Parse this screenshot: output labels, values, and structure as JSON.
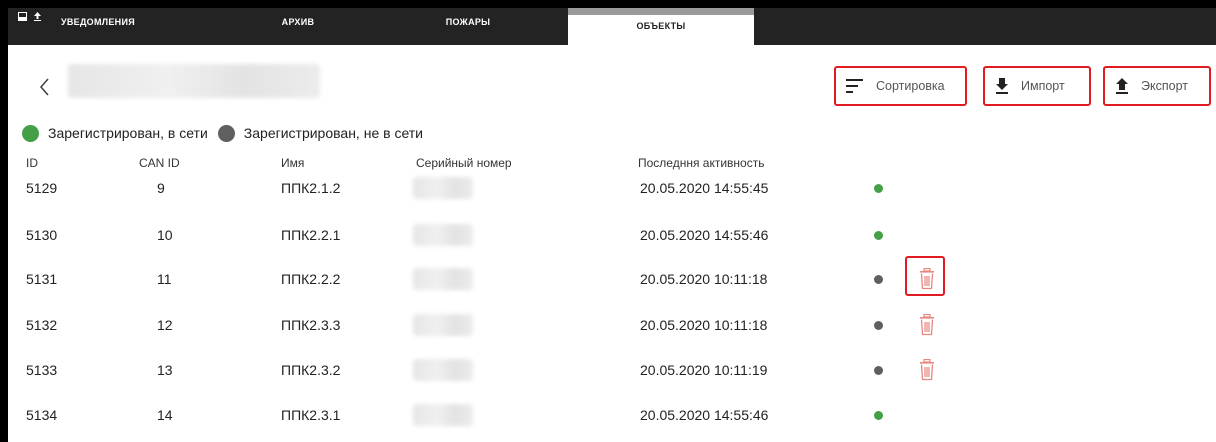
{
  "tabs": [
    {
      "label": "Уведомления",
      "active": false
    },
    {
      "label": "Архив",
      "active": false
    },
    {
      "label": "Пожары",
      "active": false
    },
    {
      "label": "Объекты",
      "active": true
    }
  ],
  "toolbar": {
    "sort_label": "Сортировка",
    "import_label": "Импорт",
    "export_label": "Экспорт"
  },
  "legend": {
    "online_label": "Зарегистрирован, в сети",
    "offline_label": "Зарегистрирован, не в сети",
    "online_color": "#43a047",
    "offline_color": "#5f5f5f"
  },
  "table": {
    "headers": [
      "ID",
      "CAN ID",
      "Имя",
      "Серийный номер",
      "Последння активность"
    ],
    "rows": [
      {
        "id": "5129",
        "can_id": "9",
        "name": "ППК2.1.2",
        "last_activity": "20.05.2020 14:55:45",
        "status": "online",
        "deletable": false
      },
      {
        "id": "5130",
        "can_id": "10",
        "name": "ППК2.2.1",
        "last_activity": "20.05.2020 14:55:46",
        "status": "online",
        "deletable": false
      },
      {
        "id": "5131",
        "can_id": "11",
        "name": "ППК2.2.2",
        "last_activity": "20.05.2020 10:11:18",
        "status": "offline",
        "deletable": true
      },
      {
        "id": "5132",
        "can_id": "12",
        "name": "ППК2.3.3",
        "last_activity": "20.05.2020 10:11:18",
        "status": "offline",
        "deletable": true
      },
      {
        "id": "5133",
        "can_id": "13",
        "name": "ППК2.3.2",
        "last_activity": "20.05.2020 10:11:19",
        "status": "offline",
        "deletable": true
      },
      {
        "id": "5134",
        "can_id": "14",
        "name": "ППК2.3.1",
        "last_activity": "20.05.2020 14:55:46",
        "status": "online",
        "deletable": false
      }
    ]
  },
  "colors": {
    "tabbar": "#232323",
    "highlight": "#e11b22",
    "trash": "#e8867f"
  },
  "icons": [
    "back-arrow-icon",
    "sort-icon",
    "download-icon",
    "upload-icon",
    "trash-icon",
    "window-icon",
    "upload-small-icon"
  ]
}
